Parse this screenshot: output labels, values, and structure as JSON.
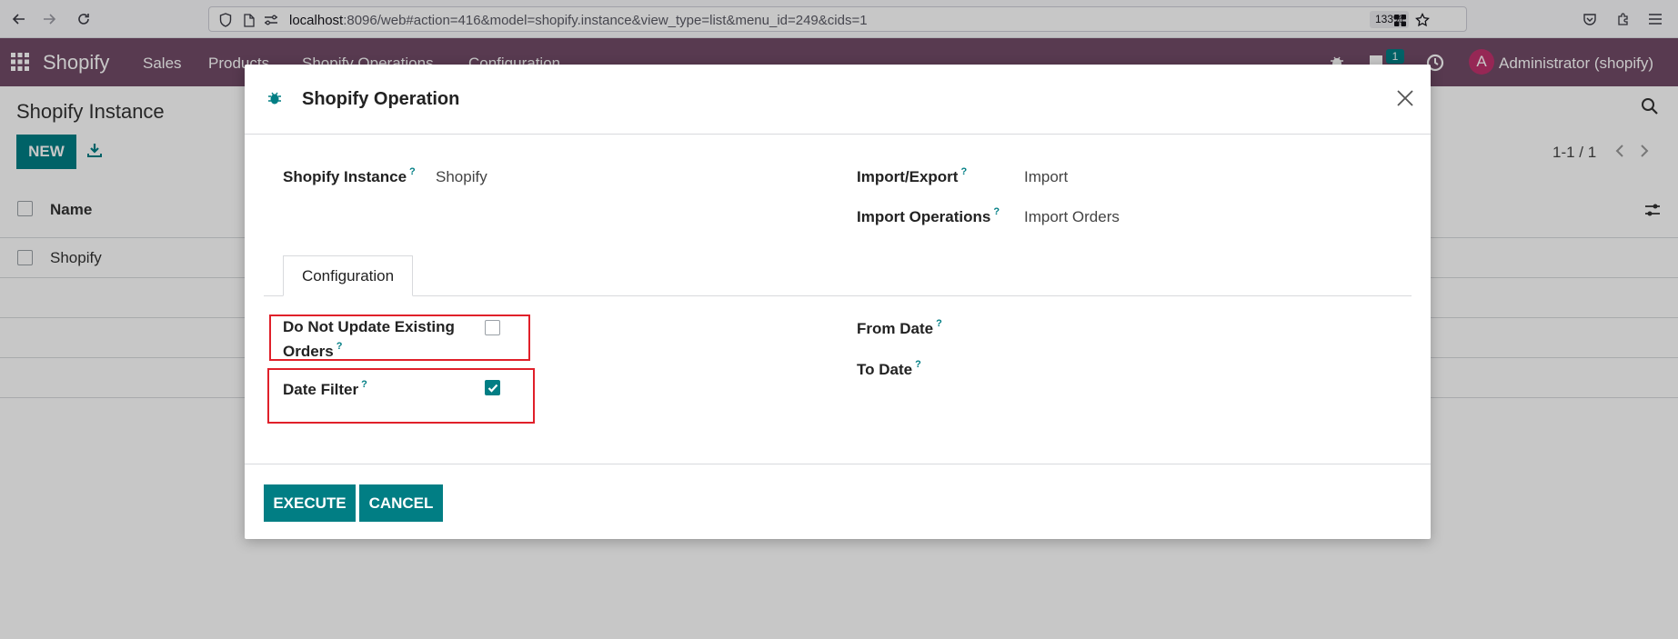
{
  "browser": {
    "url_host": "localhost",
    "url_rest": ":8096/web#action=416&model=shopify.instance&view_type=list&menu_id=249&cids=1",
    "zoom": "133%"
  },
  "navbar": {
    "brand": "Shopify",
    "menu": [
      "Sales",
      "Products",
      "Shopify Operations",
      "Configuration"
    ],
    "message_count": "1",
    "avatar_letter": "A",
    "user": "Administrator (shopify)"
  },
  "list": {
    "title": "Shopify Instance",
    "new_button": "NEW",
    "pager": "1-1 / 1",
    "column_name": "Name",
    "rows": [
      "Shopify"
    ]
  },
  "modal": {
    "title": "Shopify Operation",
    "fields": {
      "instance_label": "Shopify Instance",
      "instance_value": "Shopify",
      "import_export_label": "Import/Export",
      "import_export_value": "Import",
      "import_ops_label": "Import Operations",
      "import_ops_value": "Import Orders"
    },
    "tab": "Configuration",
    "config": {
      "no_update_label_line1": "Do Not Update Existing",
      "no_update_label_line2": "Orders",
      "no_update_checked": false,
      "date_filter_label": "Date Filter",
      "date_filter_checked": true,
      "from_date_label": "From Date",
      "to_date_label": "To Date"
    },
    "execute_button": "EXECUTE",
    "cancel_button": "CANCEL"
  },
  "colors": {
    "primary": "#017e84",
    "navbar": "#714b67",
    "highlight": "#e0202a"
  }
}
